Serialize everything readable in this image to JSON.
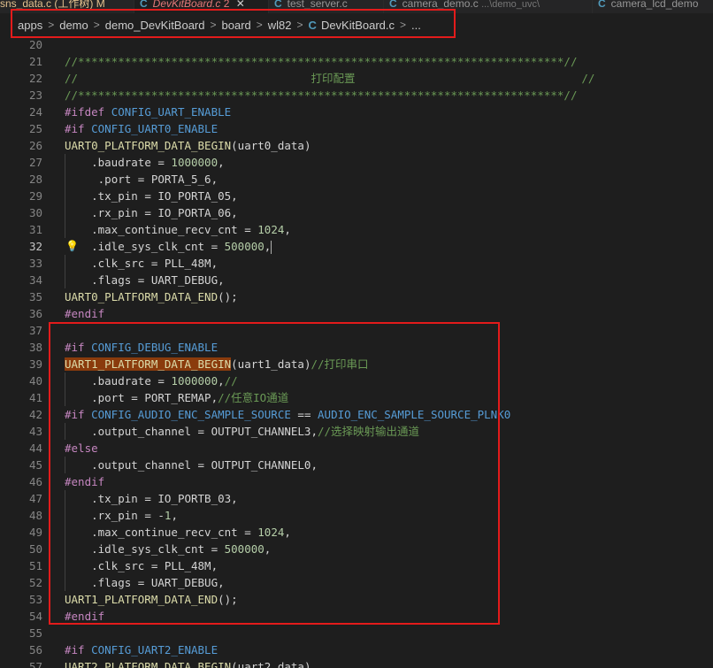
{
  "tabs": [
    {
      "label": "sns_data.c (工作树)",
      "suffix": "M",
      "active": false
    },
    {
      "label": "DevKitBoard.c",
      "suffix": "2",
      "active": true
    },
    {
      "label": "test_server.c",
      "active": false
    },
    {
      "label": "camera_demo.c",
      "hint": "...\\demo_uvc\\",
      "active": false
    },
    {
      "label": "camera_lcd_demo",
      "active": false
    }
  ],
  "breadcrumb": [
    "apps",
    "demo",
    "demo_DevKitBoard",
    "board",
    "wl82",
    "DevKitBoard.c",
    "..."
  ],
  "colors": {
    "highlight_box": "#e31b1b",
    "background": "#1e1e1e"
  },
  "lines": [
    {
      "n": "20",
      "html": ""
    },
    {
      "n": "21",
      "html": "<span class=\"cm\">//*************************************************************************//</span>"
    },
    {
      "n": "22",
      "html": "<span class=\"cm\">//                                   打印配置                                  //</span>"
    },
    {
      "n": "23",
      "html": "<span class=\"cm\">//*************************************************************************//</span>"
    },
    {
      "n": "24",
      "html": "<span class=\"kw\">#ifdef</span> <span class=\"mac\">CONFIG_UART_ENABLE</span>"
    },
    {
      "n": "25",
      "html": "<span class=\"kw\">#if</span> <span class=\"mac\">CONFIG_UART0_ENABLE</span>"
    },
    {
      "n": "26",
      "html": "<span class=\"fn\">UART0_PLATFORM_DATA_BEGIN</span><span class=\"pl\">(uart0_data)</span>"
    },
    {
      "n": "27",
      "guide": true,
      "html": "    <span class=\"pl\">.baudrate = </span><span class=\"nm\">1000000</span><span class=\"pl\">,</span>"
    },
    {
      "n": "28",
      "guide": true,
      "html": "     <span class=\"pl\">.port = PORTA_5_6,</span>"
    },
    {
      "n": "29",
      "guide": true,
      "html": "    <span class=\"pl\">.tx_pin = IO_PORTA_05,</span>"
    },
    {
      "n": "30",
      "guide": true,
      "html": "    <span class=\"pl\">.rx_pin = IO_PORTA_06,</span>"
    },
    {
      "n": "31",
      "guide": true,
      "html": "    <span class=\"pl\">.max_continue_recv_cnt = </span><span class=\"nm\">1024</span><span class=\"pl\">,</span>"
    },
    {
      "n": "32",
      "cur": true,
      "bulb": true,
      "html": "    <span class=\"pl\">.idle_sys_clk_cnt = </span><span class=\"nm\">500000</span><span class=\"pl\">,</span><span class=\"cursor\"></span>"
    },
    {
      "n": "33",
      "guide": true,
      "html": "    <span class=\"pl\">.clk_src = PLL_48M,</span>"
    },
    {
      "n": "34",
      "guide": true,
      "html": "    <span class=\"pl\">.flags = UART_DEBUG,</span>"
    },
    {
      "n": "35",
      "html": "<span class=\"fn\">UART0_PLATFORM_DATA_END</span><span class=\"pl\">();</span>"
    },
    {
      "n": "36",
      "html": "<span class=\"kw\">#endif</span>"
    },
    {
      "n": "37",
      "html": ""
    },
    {
      "n": "38",
      "html": "<span class=\"kw\">#if</span> <span class=\"mac\">CONFIG_DEBUG_ENABLE</span>"
    },
    {
      "n": "39",
      "html": "<span class=\"fn hl\">UART1_PLATFORM_DATA_BEGIN</span><span class=\"pl\">(uart1_data)</span><span class=\"cm\">//打印串口</span>"
    },
    {
      "n": "40",
      "guide": true,
      "html": "    <span class=\"pl\">.baudrate = </span><span class=\"nm\">1000000</span><span class=\"pl\">,</span><span class=\"cm\">//</span>"
    },
    {
      "n": "41",
      "guide": true,
      "html": "    <span class=\"pl\">.port = PORT_REMAP,</span><span class=\"cm\">//任意IO通道</span>"
    },
    {
      "n": "42",
      "html": "<span class=\"kw\">#if</span> <span class=\"mac\">CONFIG_AUDIO_ENC_SAMPLE_SOURCE</span> <span class=\"pl\">==</span> <span class=\"mac\">AUDIO_ENC_SAMPLE_SOURCE_PLNK0</span>"
    },
    {
      "n": "43",
      "guide": true,
      "html": "    <span class=\"pl\">.output_channel = OUTPUT_CHANNEL3,</span><span class=\"cm\">//选择映射输出通道</span>"
    },
    {
      "n": "44",
      "html": "<span class=\"kw\">#else</span>"
    },
    {
      "n": "45",
      "guide": true,
      "html": "    <span class=\"pl\">.output_channel = OUTPUT_CHANNEL0,</span>"
    },
    {
      "n": "46",
      "html": "<span class=\"kw\">#endif</span>"
    },
    {
      "n": "47",
      "guide": true,
      "html": "    <span class=\"pl\">.tx_pin = IO_PORTB_03,</span>"
    },
    {
      "n": "48",
      "guide": true,
      "html": "    <span class=\"pl\">.rx_pin = -</span><span class=\"nm\">1</span><span class=\"pl\">,</span>"
    },
    {
      "n": "49",
      "guide": true,
      "html": "    <span class=\"pl\">.max_continue_recv_cnt = </span><span class=\"nm\">1024</span><span class=\"pl\">,</span>"
    },
    {
      "n": "50",
      "guide": true,
      "html": "    <span class=\"pl\">.idle_sys_clk_cnt = </span><span class=\"nm\">500000</span><span class=\"pl\">,</span>"
    },
    {
      "n": "51",
      "guide": true,
      "html": "    <span class=\"pl\">.clk_src = PLL_48M,</span>"
    },
    {
      "n": "52",
      "guide": true,
      "html": "    <span class=\"pl\">.flags = UART_DEBUG,</span>"
    },
    {
      "n": "53",
      "html": "<span class=\"fn\">UART1_PLATFORM_DATA_END</span><span class=\"pl\">();</span>"
    },
    {
      "n": "54",
      "html": "<span class=\"kw\">#endif</span>"
    },
    {
      "n": "55",
      "html": ""
    },
    {
      "n": "56",
      "html": "<span class=\"kw\">#if</span> <span class=\"mac\">CONFIG_UART2_ENABLE</span>"
    },
    {
      "n": "57",
      "html": "<span class=\"fn\">UART2_PLATFORM_DATA_BEGIN</span><span class=\"pl\">(uart2_data)</span>"
    }
  ]
}
